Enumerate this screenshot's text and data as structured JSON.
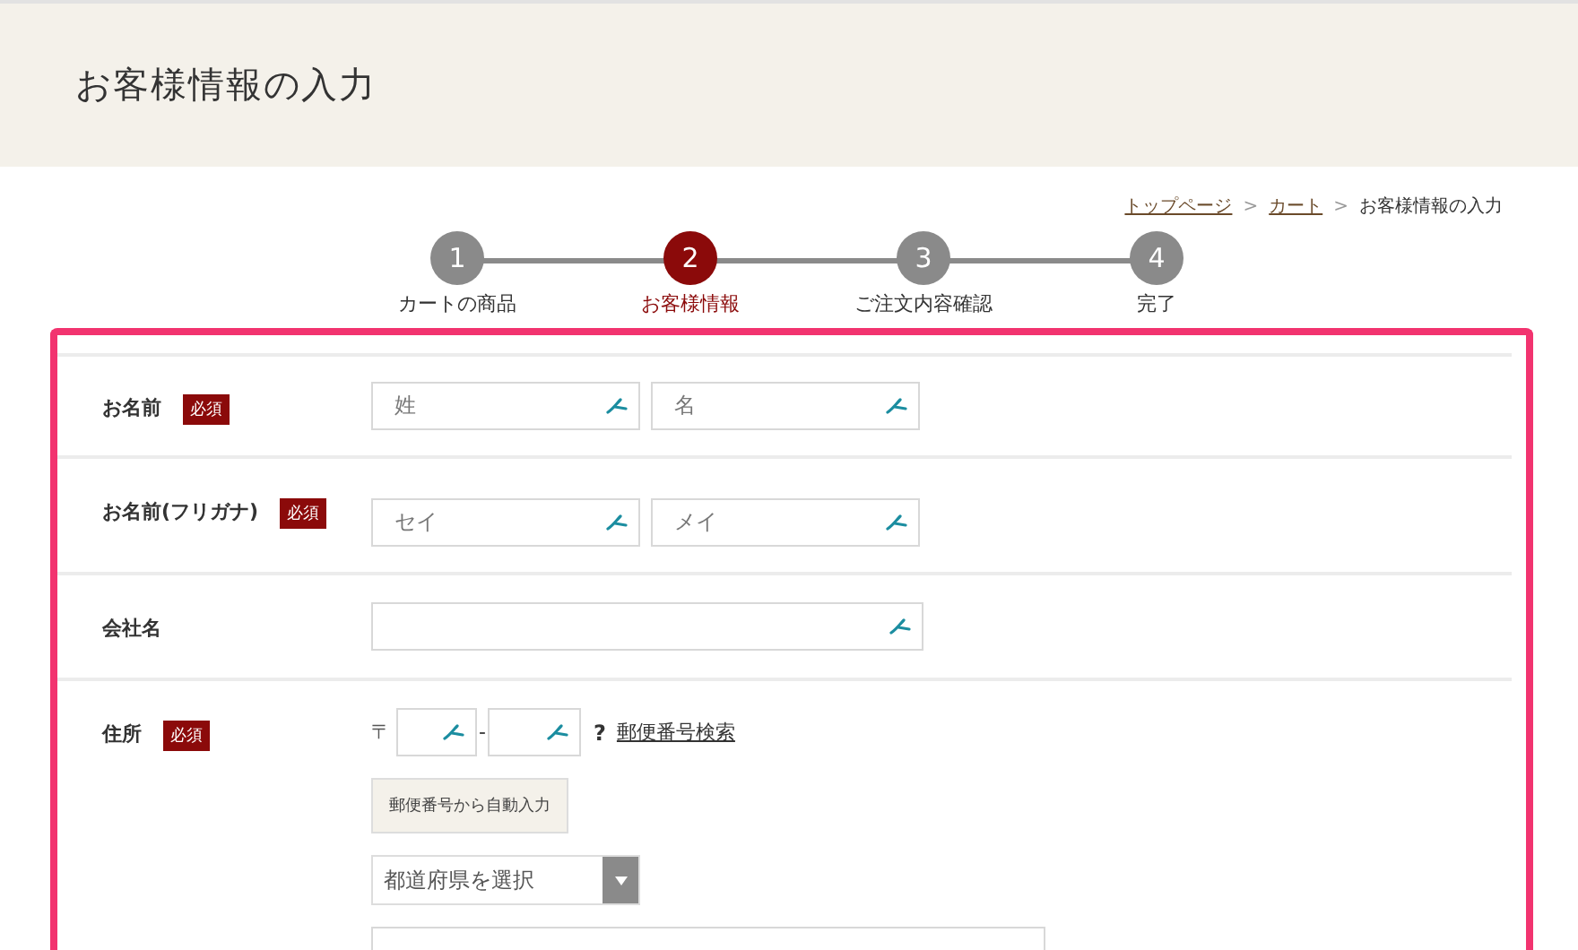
{
  "header": {
    "title": "お客様情報の入力"
  },
  "breadcrumb": [
    {
      "label": "トップページ",
      "link": true
    },
    {
      "label": "カート",
      "link": true
    },
    {
      "label": "お客様情報の入力",
      "link": false
    }
  ],
  "breadcrumb_separator": ">",
  "steps": [
    {
      "number": "1",
      "label": "カートの商品",
      "selected": false
    },
    {
      "number": "2",
      "label": "お客様情報",
      "selected": true
    },
    {
      "number": "3",
      "label": "ご注文内容確認",
      "selected": false
    },
    {
      "number": "4",
      "label": "完了",
      "selected": false
    }
  ],
  "form": {
    "rows": [
      {
        "kind": "pair",
        "label": "お名前",
        "badge": "必須",
        "fields": [
          {
            "placeholder": "姓"
          },
          {
            "placeholder": "名"
          }
        ]
      },
      {
        "kind": "pair",
        "label": "お名前(フリガナ)",
        "badge": "必須",
        "fields": [
          {
            "placeholder": "セイ"
          },
          {
            "placeholder": "メイ"
          }
        ]
      },
      {
        "kind": "single",
        "label": "会社名"
      },
      {
        "kind": "address",
        "label": "住所",
        "badge": "必須",
        "postal_mark": "〒",
        "separator": "-",
        "help": "?",
        "search_link": "郵便番号検索",
        "autofill_button": "郵便番号から自動入力",
        "prefecture_select": "都道府県を選択"
      }
    ]
  }
}
